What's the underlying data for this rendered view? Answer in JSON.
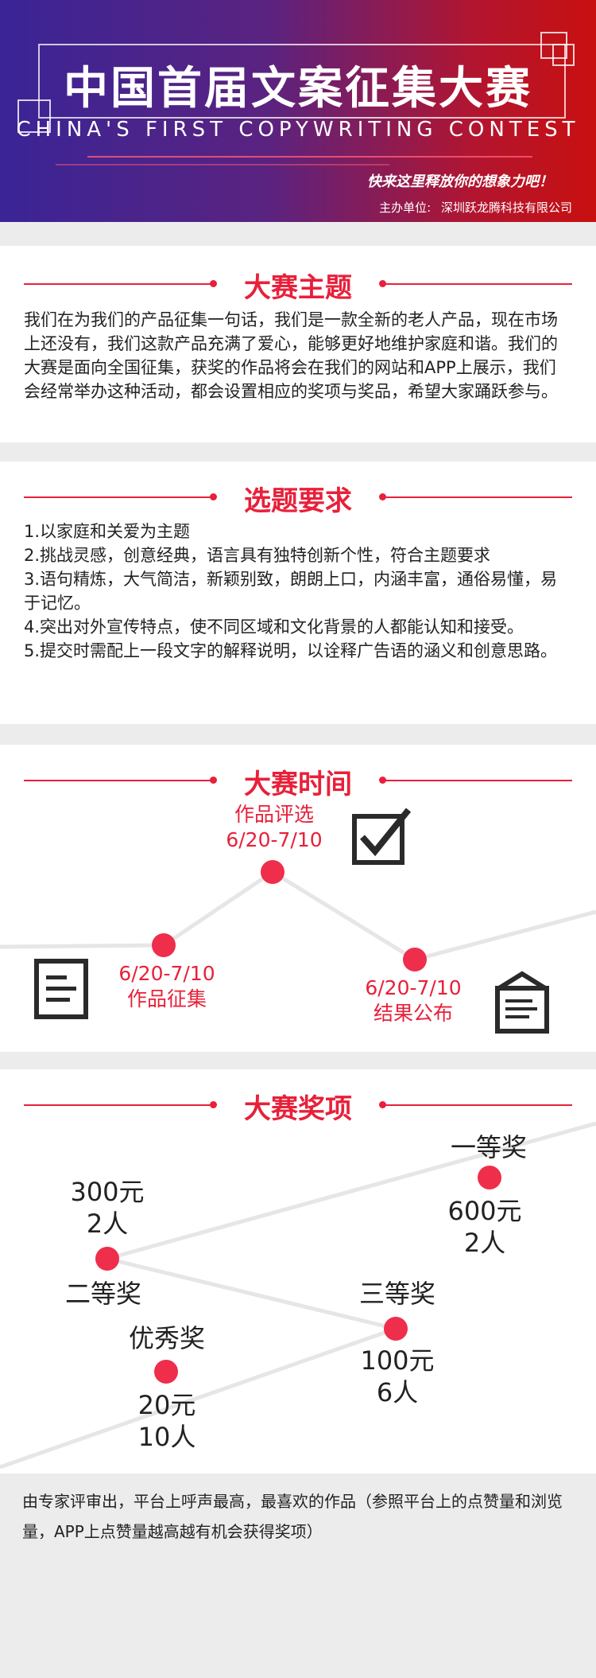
{
  "banner": {
    "title": "中国首届文案征集大赛",
    "subtitle": "CHINA'S FIRST COPYWRITING CONTEST",
    "slogan": "快来这里释放你的想象力吧！",
    "host_label": "主办单位:",
    "host_name": "深圳跃龙腾科技有限公司"
  },
  "theme": {
    "title": "大赛主题",
    "body": "我们在为我们的产品征集一句话，我们是一款全新的老人产品，现在市场上还没有，我们这款产品充满了爱心，能够更好地维护家庭和谐。我们的大赛是面向全国征集，获奖的作品将会在我们的网站和APP上展示，我们会经常举办这种活动，都会设置相应的奖项与奖品，希望大家踊跃参与。"
  },
  "requirements": {
    "title": "选题要求",
    "items": [
      "1.以家庭和关爱为主题",
      "2.挑战灵感，创意经典，语言具有独特创新个性，符合主题要求",
      "3.语句精炼，大气简洁，新颖别致，朗朗上口，内涵丰富，通俗易懂，易于记忆。",
      "4.突出对外宣传特点，使不同区域和文化背景的人都能认知和接受。",
      "5.提交时需配上一段文字的解释说明，以诠释广告语的涵义和创意思路。"
    ]
  },
  "timeline": {
    "title": "大赛时间",
    "stages": [
      {
        "date": "6/20-7/10",
        "name": "作品征集",
        "icon": "document-icon"
      },
      {
        "date": "6/20-7/10",
        "name": "作品评选",
        "icon": "checkbox-icon"
      },
      {
        "date": "6/20-7/10",
        "name": "结果公布",
        "icon": "notice-board-icon"
      }
    ]
  },
  "prizes": {
    "title": "大赛奖项",
    "first": {
      "name": "一等奖",
      "amount": "600元",
      "count": "2人"
    },
    "second": {
      "name": "二等奖",
      "amount": "300元",
      "count": "2人"
    },
    "third": {
      "name": "三等奖",
      "amount": "100元",
      "count": "6人"
    },
    "excellent": {
      "name": "优秀奖",
      "amount": "20元",
      "count": "10人"
    }
  },
  "footer": {
    "note": "由专家评审出，平台上呼声最高，最喜欢的作品（参照平台上的点赞量和浏览量，APP上点赞量越高越有机会获得奖项）"
  },
  "colors": {
    "accent": "#e8203a",
    "banner_left": "#3a2496",
    "banner_right": "#c81010"
  }
}
